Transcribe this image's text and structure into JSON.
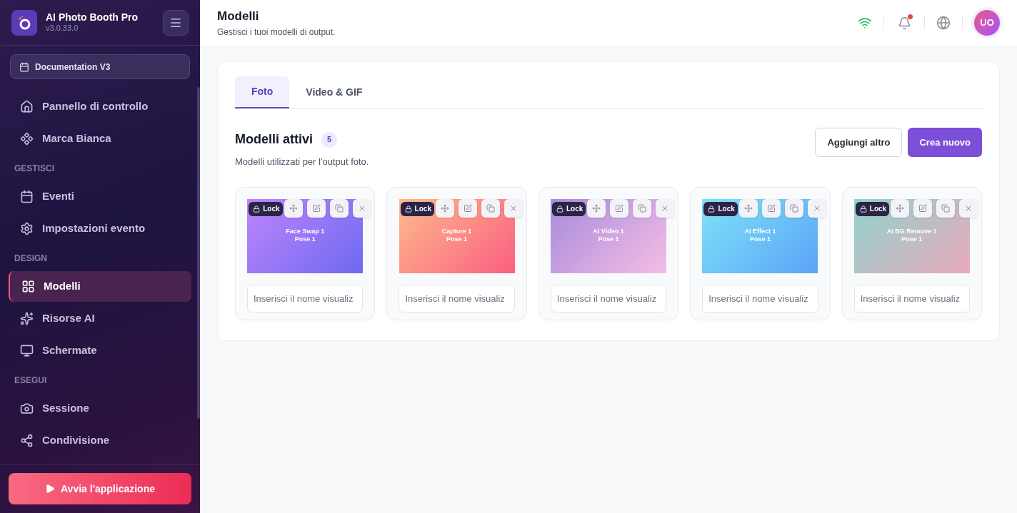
{
  "app": {
    "name": "AI Photo Booth Pro",
    "version": "v3.0.33.0"
  },
  "event_selector": {
    "label": "Documentation V3"
  },
  "sidebar": {
    "sections": [
      {
        "items": [
          {
            "label": "Pannello di controllo",
            "selected": false
          },
          {
            "label": "Marca Bianca",
            "selected": false
          }
        ]
      },
      {
        "heading": "GESTISCI",
        "items": [
          {
            "label": "Eventi",
            "selected": false
          },
          {
            "label": "Impostazioni evento",
            "selected": false
          }
        ]
      },
      {
        "heading": "DESIGN",
        "items": [
          {
            "label": "Modelli",
            "selected": true
          },
          {
            "label": "Risorse AI",
            "selected": false
          },
          {
            "label": "Schermate",
            "selected": false
          }
        ]
      },
      {
        "heading": "ESEGUI",
        "items": [
          {
            "label": "Sessione",
            "selected": false
          },
          {
            "label": "Condivisione",
            "selected": false
          }
        ]
      }
    ]
  },
  "launch_button": {
    "label": "Avvia l'applicazione"
  },
  "header": {
    "title": "Modelli",
    "subtitle": "Gestisci i tuoi modelli di output.",
    "notifications_unread": true,
    "avatar": "UO"
  },
  "tabs": [
    {
      "label": "Foto",
      "selected": true
    },
    {
      "label": "Video & GIF",
      "selected": false
    }
  ],
  "section": {
    "title": "Modelli attivi",
    "count": "5",
    "description": "Modelli utilizzati per l'output foto."
  },
  "buttons": {
    "secondary": "Aggiungi altro",
    "primary": "Crea nuovo"
  },
  "templates": [
    {
      "lock": "Lock",
      "preview_lines": [
        "Face Swap 1",
        "Pose 1"
      ],
      "placeholder": "Inserisci il nome visualiz"
    },
    {
      "lock": "Lock",
      "preview_lines": [
        "Capture 1",
        "Pose 1"
      ],
      "placeholder": "Inserisci il nome visualiz"
    },
    {
      "lock": "Lock",
      "preview_lines": [
        "AI Video 1",
        "Pose 1"
      ],
      "placeholder": "Inserisci il nome visualiz"
    },
    {
      "lock": "Lock",
      "preview_lines": [
        "AI Effect 1",
        "Pose 1"
      ],
      "placeholder": "Inserisci il nome visualiz"
    },
    {
      "lock": "Lock",
      "preview_lines": [
        "AI BG Remove 1",
        "Pose 1"
      ],
      "placeholder": "Inserisci il nome visualiz"
    }
  ]
}
